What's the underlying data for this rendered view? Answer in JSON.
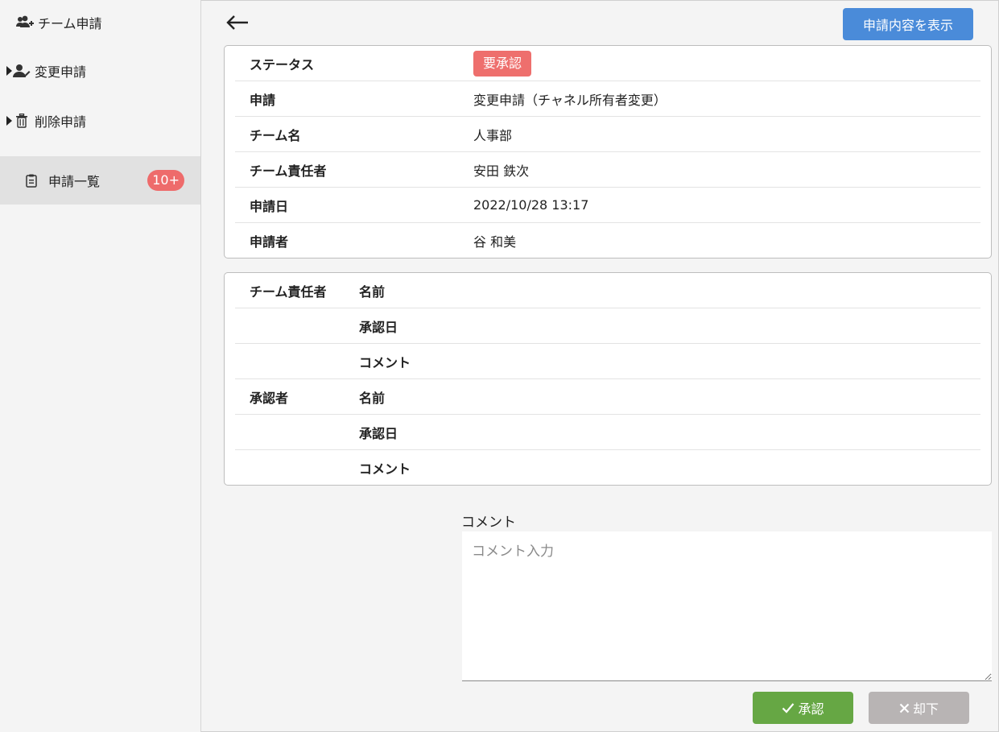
{
  "sidebar": {
    "header": {
      "label": "チーム申請",
      "icon": "users-plus-icon"
    },
    "items": [
      {
        "label": "変更申請",
        "icon": "user-edit-icon",
        "caret": "caret-right-icon"
      },
      {
        "label": "削除申請",
        "icon": "trash-icon",
        "caret": "caret-right-icon"
      },
      {
        "label": "申請一覧",
        "icon": "clipboard-icon",
        "badge": "10+",
        "active": true
      }
    ]
  },
  "toolbar": {
    "back_icon": "arrow-left-icon",
    "show_button": "申請内容を表示"
  },
  "details": {
    "rows": [
      {
        "key": "ステータス",
        "value": "要承認"
      },
      {
        "key": "申請",
        "value": "変更申請（チャネル所有者変更）"
      },
      {
        "key": "チーム名",
        "value": "人事部"
      },
      {
        "key": "チーム責任者",
        "value": "安田 鉄次"
      },
      {
        "key": "申請日",
        "value": "2022/10/28 13:17"
      },
      {
        "key": "申請者",
        "value": "谷 和美"
      }
    ]
  },
  "approvals": {
    "groups": [
      {
        "label": "チーム責任者",
        "fields": [
          "名前",
          "承認日",
          "コメント"
        ]
      },
      {
        "label": "承認者",
        "fields": [
          "名前",
          "承認日",
          "コメント"
        ]
      }
    ]
  },
  "comment": {
    "label": "コメント",
    "placeholder": "コメント入力",
    "value": ""
  },
  "actions": {
    "approve": "承認",
    "reject": "却下"
  },
  "colors": {
    "status_badge": "#ee6f6d",
    "primary_button": "#4a8bd9",
    "approve_button": "#66a744",
    "reject_button": "#b8b4b4",
    "count_badge": "#ee6b6b"
  }
}
